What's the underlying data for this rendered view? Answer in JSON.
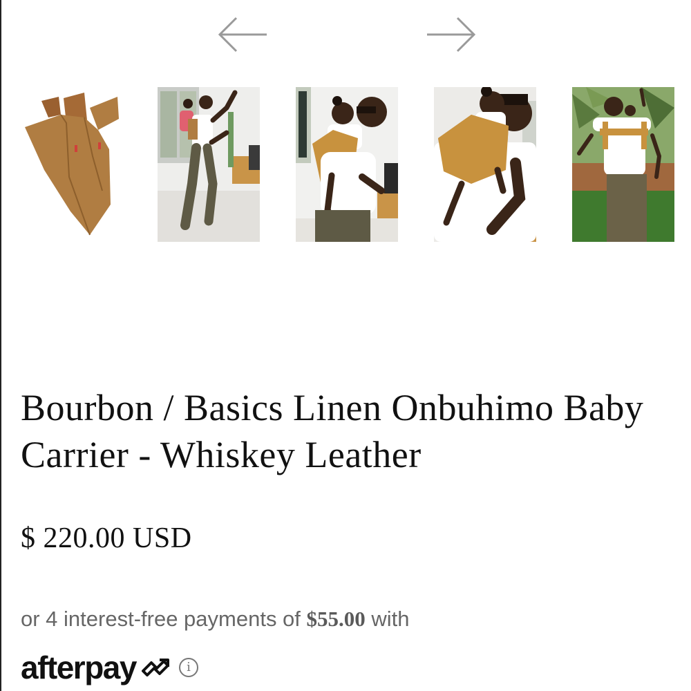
{
  "gallery": {
    "prev_icon": "arrow-left-icon",
    "next_icon": "arrow-right-icon",
    "thumbnails": [
      {
        "alt": "carrier-product-photo"
      },
      {
        "alt": "father-dancing-with-child-on-back"
      },
      {
        "alt": "father-carrying-child-on-back"
      },
      {
        "alt": "father-carrying-child-closeup"
      },
      {
        "alt": "father-outdoors-with-carrier"
      }
    ]
  },
  "product": {
    "title": "Bourbon / Basics Linen Onbuhimo Baby Carrier - Whiskey Leather",
    "price": "$ 220.00 USD"
  },
  "installments": {
    "prefix": "or 4 interest-free payments of ",
    "amount": "$55.00",
    "suffix": " with"
  },
  "afterpay": {
    "wordmark": "afterpay",
    "logo_icon": "afterpay-arrows-icon",
    "info_glyph": "i"
  },
  "colors": {
    "text": "#111111",
    "muted": "#666666",
    "arrow": "#9a9a9a",
    "carrier_tan": "#b07d42",
    "leather": "#8a5a2e"
  }
}
